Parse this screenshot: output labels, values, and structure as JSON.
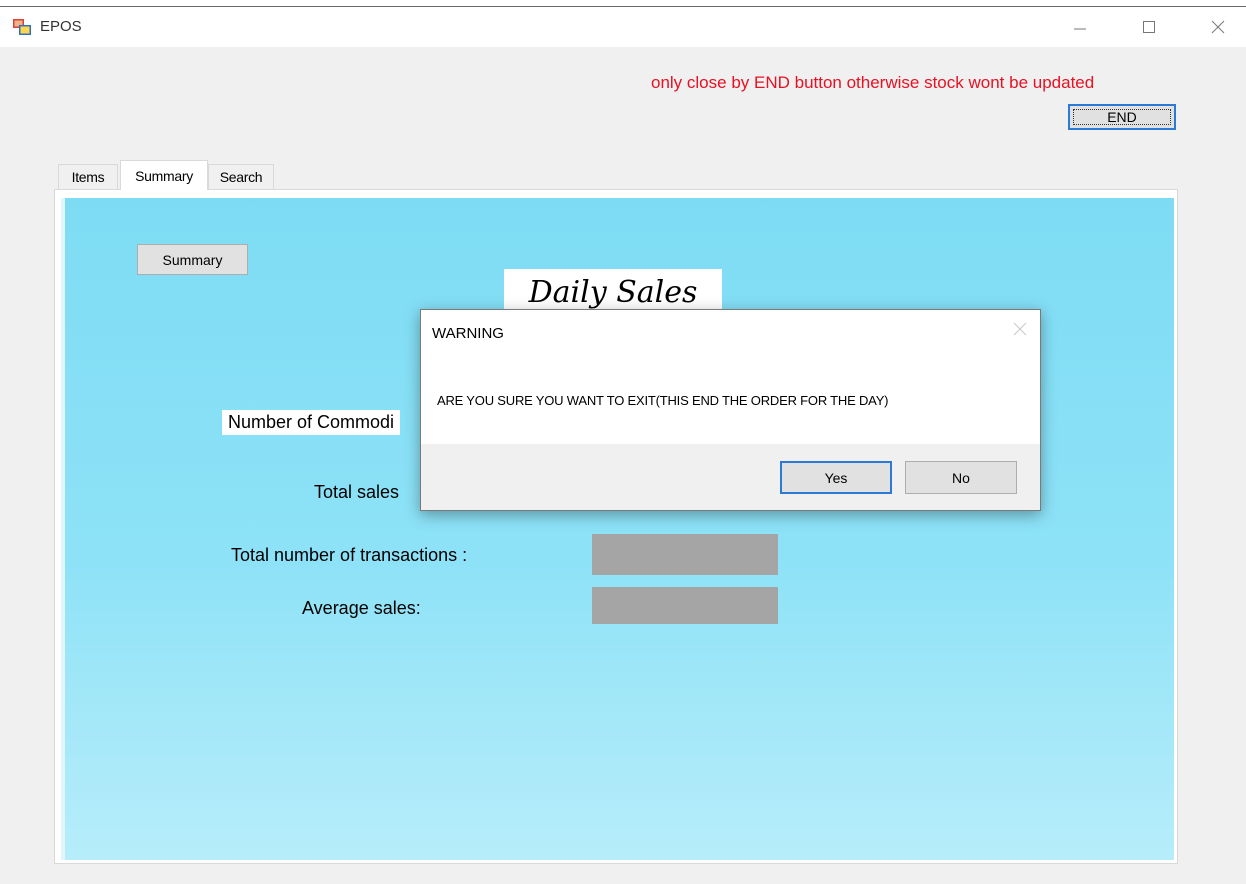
{
  "window": {
    "title": "EPOS",
    "controls": [
      "minimize",
      "maximize",
      "close"
    ]
  },
  "header": {
    "warning_text": "only close by END button otherwise stock wont be updated",
    "end_button_label": "END",
    "warning_color": "#e81123"
  },
  "tabs": [
    {
      "label": "Items",
      "active": false
    },
    {
      "label": "Summary",
      "active": true
    },
    {
      "label": "Search",
      "active": false
    }
  ],
  "summary": {
    "button_label": "Summary",
    "title": "Daily Sales",
    "fields": [
      {
        "label": "Number of Commodi",
        "value": ""
      },
      {
        "label": "Total sales",
        "value": ""
      },
      {
        "label": "Total number of transactions :",
        "value": ""
      },
      {
        "label": "Average sales:",
        "value": ""
      }
    ]
  },
  "dialog": {
    "title": "WARNING",
    "message": "ARE YOU SURE YOU WANT TO EXIT(THIS END THE ORDER FOR THE DAY)",
    "yes_label": "Yes",
    "no_label": "No"
  }
}
